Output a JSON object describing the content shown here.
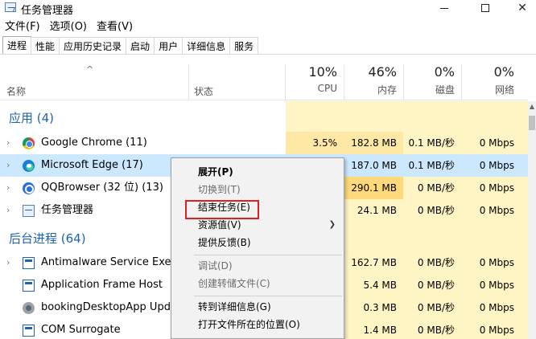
{
  "window": {
    "title": "任务管理器"
  },
  "menu": [
    "文件(F)",
    "选项(O)",
    "查看(V)"
  ],
  "tabs": [
    "进程",
    "性能",
    "应用历史记录",
    "启动",
    "用户",
    "详细信息",
    "服务"
  ],
  "columns": {
    "name": "名称",
    "status": "状态",
    "cpu": {
      "pct": "10%",
      "label": "CPU"
    },
    "memory": {
      "pct": "46%",
      "label": "内存"
    },
    "disk": {
      "pct": "0%",
      "label": "磁盘"
    },
    "network": {
      "pct": "0%",
      "label": "网络"
    }
  },
  "groups": {
    "apps": "应用 (4)",
    "background": "后台进程 (64)"
  },
  "rows": [
    {
      "name": "Google Chrome (11)",
      "cpu": "3.5%",
      "memory": "182.8 MB",
      "disk": "0.1 MB/秒",
      "network": "0 Mbps",
      "icon": "chrome-icon"
    },
    {
      "name": "Microsoft Edge (17)",
      "cpu": "",
      "memory": "187.0 MB",
      "disk": "0.1 MB/秒",
      "network": "0 Mbps",
      "icon": "edge-icon"
    },
    {
      "name": "QQBrowser (32 位) (13)",
      "cpu": "",
      "memory": "290.1 MB",
      "disk": "0 MB/秒",
      "network": "0 Mbps",
      "icon": "qqbrowser-icon"
    },
    {
      "name": "任务管理器",
      "cpu": "",
      "memory": "24.1 MB",
      "disk": "0 MB/秒",
      "network": "0 Mbps",
      "icon": "task-manager-icon"
    },
    {
      "name": "Antimalware Service Executa",
      "cpu": "",
      "memory": "162.7 MB",
      "disk": "0 MB/秒",
      "network": "0 Mbps",
      "icon": "service-icon"
    },
    {
      "name": "Application Frame Host",
      "cpu": "",
      "memory": "5.4 MB",
      "disk": "0 MB/秒",
      "network": "0 Mbps",
      "icon": "window-icon"
    },
    {
      "name": "bookingDesktopApp Updat",
      "cpu": "",
      "memory": "0.3 MB",
      "disk": "0 MB/秒",
      "network": "0 Mbps",
      "icon": "booking-icon"
    },
    {
      "name": "COM Surrogate",
      "cpu": "",
      "memory": "1.4 MB",
      "disk": "0 MB/秒",
      "network": "0 Mbps",
      "icon": "window-icon"
    }
  ],
  "context_menu": [
    "展开(P)",
    "切换到(T)",
    "结束任务(E)",
    "资源值(V)",
    "提供反馈(B)",
    "调试(D)",
    "创建转储文件(C)",
    "转到详细信息(G)",
    "打开文件所在的位置(O)"
  ]
}
